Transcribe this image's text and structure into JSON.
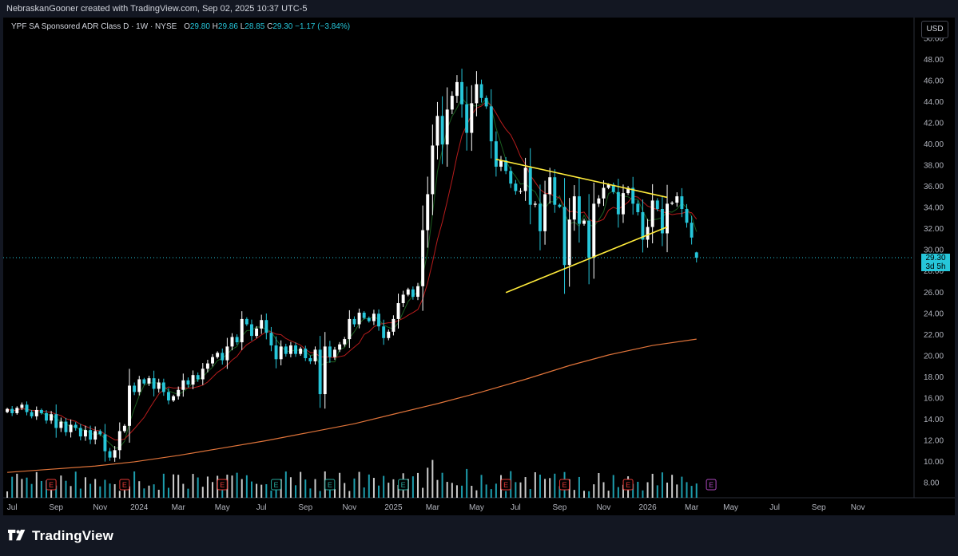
{
  "header": {
    "attribution": "NebraskanGooner created with TradingView.com, Sep 02, 2025 10:37 UTC-5"
  },
  "legend": {
    "symbol": "YPF SA Sponsored ADR Class D · 1W · NYSE",
    "o_label": "O",
    "o_value": "29.80",
    "h_label": "H",
    "h_value": "29.86",
    "l_label": "L",
    "l_value": "28.85",
    "c_label": "C",
    "c_value": "29.30",
    "change": "−1.17 (−3.84%)"
  },
  "currency_button": "USD",
  "price_tag": {
    "price": "29.30",
    "countdown": "3d 5h"
  },
  "footer": {
    "brand": "TradingView"
  },
  "colors": {
    "up": "#ffffff",
    "down": "#26c6da",
    "ema_fast": "#1b5e20",
    "ema_mid": "#b71c1c",
    "ema_slow": "#e0743a",
    "trendline": "#ffeb3b",
    "earnings_past": "#e53935",
    "earnings_future": "#ab47bc",
    "dividend": "#26a69a"
  },
  "chart_data": {
    "type": "candlestick",
    "symbol": "YPF",
    "interval": "1W",
    "y_axis": {
      "min": 6.6,
      "max": 52,
      "ticks": [
        "50.00",
        "48.00",
        "46.00",
        "44.00",
        "42.00",
        "40.00",
        "38.00",
        "36.00",
        "34.00",
        "32.00",
        "30.00",
        "28.00",
        "26.00",
        "24.00",
        "22.00",
        "20.00",
        "18.00",
        "16.00",
        "14.00",
        "12.00",
        "10.00",
        "8.00"
      ]
    },
    "x_axis": {
      "labels": [
        {
          "text": "Jul",
          "week": 1
        },
        {
          "text": "Sep",
          "week": 10
        },
        {
          "text": "Nov",
          "week": 19
        },
        {
          "text": "2024",
          "week": 27
        },
        {
          "text": "Mar",
          "week": 35
        },
        {
          "text": "May",
          "week": 44
        },
        {
          "text": "Jul",
          "week": 52
        },
        {
          "text": "Sep",
          "week": 61
        },
        {
          "text": "Nov",
          "week": 70
        },
        {
          "text": "2025",
          "week": 79
        },
        {
          "text": "Mar",
          "week": 87
        },
        {
          "text": "May",
          "week": 96
        },
        {
          "text": "Jul",
          "week": 104
        },
        {
          "text": "Sep",
          "week": 113
        },
        {
          "text": "Nov",
          "week": 122
        },
        {
          "text": "2026",
          "week": 131
        },
        {
          "text": "Mar",
          "week": 140
        },
        {
          "text": "May",
          "week": 148
        },
        {
          "text": "Jul",
          "week": 157
        },
        {
          "text": "Sep",
          "week": 166
        },
        {
          "text": "Nov",
          "week": 174
        }
      ],
      "total_weeks": 186
    },
    "closes": [
      15.0,
      14.6,
      15.1,
      15.4,
      14.7,
      14.3,
      14.9,
      14.6,
      13.9,
      14.5,
      13.2,
      13.8,
      12.8,
      13.5,
      13.2,
      12.4,
      13.0,
      12.1,
      12.9,
      12.6,
      11.0,
      10.4,
      11.1,
      12.9,
      13.4,
      17.2,
      16.6,
      17.8,
      17.4,
      17.9,
      16.9,
      17.5,
      16.6,
      15.8,
      16.2,
      16.8,
      17.7,
      17.3,
      18.2,
      17.8,
      18.8,
      19.3,
      19.9,
      20.3,
      19.6,
      20.9,
      21.8,
      21.3,
      23.5,
      23.0,
      21.9,
      22.6,
      23.4,
      22.2,
      21.0,
      19.7,
      20.9,
      20.2,
      21.0,
      20.2,
      20.7,
      19.8,
      19.5,
      20.6,
      16.4,
      20.9,
      19.9,
      20.6,
      21.1,
      21.6,
      23.5,
      23.0,
      24.1,
      23.6,
      23.3,
      24.0,
      22.8,
      21.7,
      22.3,
      23.5,
      25.0,
      25.8,
      26.3,
      25.6,
      26.6,
      31.9,
      35.3,
      39.9,
      42.7,
      40.0,
      43.3,
      44.6,
      45.9,
      43.8,
      41.1,
      43.9,
      45.7,
      44.4,
      43.6,
      40.3,
      37.9,
      38.5,
      37.5,
      36.3,
      35.6,
      35.6,
      37.8,
      34.3,
      34.4,
      31.8,
      35.3,
      36.9,
      34.3,
      34.1,
      28.6,
      32.9,
      35.1,
      32.5,
      32.8,
      29.3,
      34.4,
      34.9,
      35.9,
      36.2,
      35.5,
      33.4,
      35.4,
      35.9,
      34.4,
      33.6,
      31.0,
      32.2,
      34.7,
      33.9,
      31.6,
      34.4,
      34.5,
      35.1,
      33.9,
      32.6,
      31.2,
      29.3
    ],
    "ohlc_last": {
      "open": 29.8,
      "high": 29.86,
      "low": 28.85,
      "close": 29.3
    },
    "moving_averages": [
      {
        "color": "#1b5e20"
      },
      {
        "color": "#b71c1c"
      },
      {
        "color": "#e0743a",
        "values": [
          9.0,
          9.3,
          9.6,
          10.0,
          10.6,
          11.3,
          12.0,
          12.8,
          13.6,
          14.5,
          15.5,
          16.6,
          17.8,
          19.1,
          20.1,
          21.0,
          21.6
        ]
      }
    ],
    "trendlines": [
      {
        "from": {
          "week": 100,
          "price": 38.6
        },
        "to": {
          "week": 135,
          "price": 35.0
        }
      },
      {
        "from": {
          "week": 102,
          "price": 26.0
        },
        "to": {
          "week": 135,
          "price": 32.2
        }
      }
    ],
    "earnings": [
      {
        "week": 9,
        "type": "past"
      },
      {
        "week": 24,
        "type": "past"
      },
      {
        "week": 44,
        "type": "past"
      },
      {
        "week": 55,
        "type": "dividend"
      },
      {
        "week": 66,
        "type": "dividend"
      },
      {
        "week": 81,
        "type": "dividend"
      },
      {
        "week": 102,
        "type": "past"
      },
      {
        "week": 114,
        "type": "past"
      },
      {
        "week": 127,
        "type": "past"
      },
      {
        "week": 144,
        "type": "future"
      }
    ],
    "earnings_label": "E",
    "last_price": 29.3,
    "last_price_line": true
  }
}
